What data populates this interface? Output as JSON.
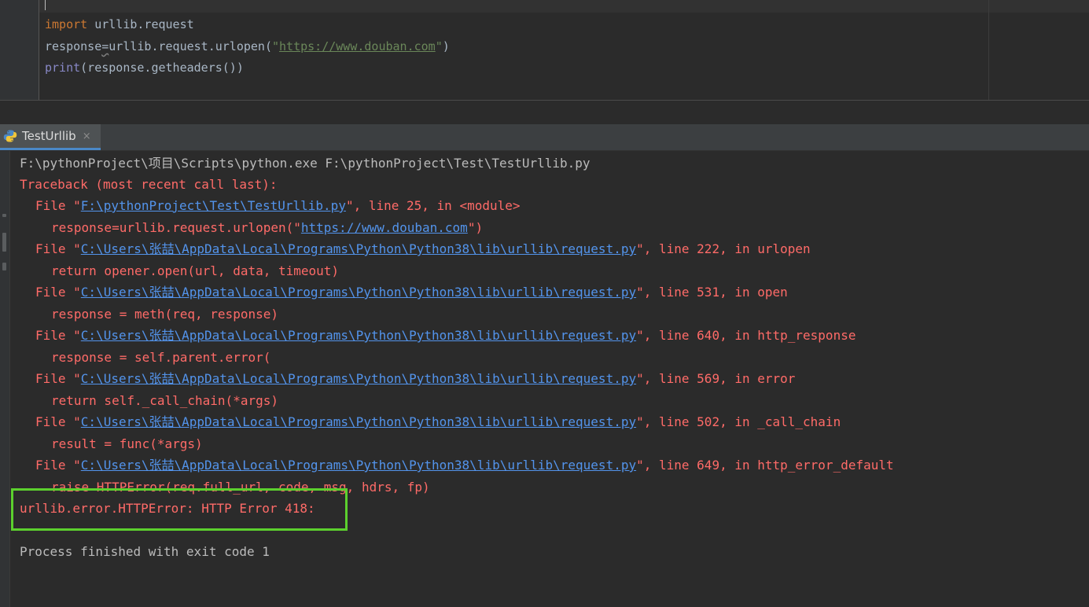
{
  "editor": {
    "lines": [
      {
        "kw": "import",
        "rest": " urllib.request"
      },
      {
        "var": "response",
        "mid": "=urllib.request.urlopen(",
        "q1": "\"",
        "url": "https://www.douban.com",
        "q2": "\"",
        "end": ")"
      },
      {
        "builtin": "print",
        "rest": "(response.getheaders())"
      }
    ]
  },
  "run_panel": {
    "tab_title": "TestUrllib",
    "tab_close": "×",
    "icon": "python-icon"
  },
  "console": {
    "command": "F:\\pythonProject\\项目\\Scripts\\python.exe F:\\pythonProject\\Test\\TestUrllib.py",
    "traceback_header": "Traceback (most recent call last):",
    "frames": [
      {
        "prefix": "File \"",
        "path": "F:\\pythonProject\\Test\\TestUrllib.py",
        "suffix": "\", line 25, in <module>",
        "code_pre": "response=urllib.request.urlopen(\"",
        "code_link": "https://www.douban.com",
        "code_post": "\")"
      },
      {
        "prefix": "File \"",
        "path": "C:\\Users\\张喆\\AppData\\Local\\Programs\\Python\\Python38\\lib\\urllib\\request.py",
        "suffix": "\", line 222, in urlopen",
        "code": "return opener.open(url, data, timeout)"
      },
      {
        "prefix": "File \"",
        "path": "C:\\Users\\张喆\\AppData\\Local\\Programs\\Python\\Python38\\lib\\urllib\\request.py",
        "suffix": "\", line 531, in open",
        "code": "response = meth(req, response)"
      },
      {
        "prefix": "File \"",
        "path": "C:\\Users\\张喆\\AppData\\Local\\Programs\\Python\\Python38\\lib\\urllib\\request.py",
        "suffix": "\", line 640, in http_response",
        "code": "response = self.parent.error("
      },
      {
        "prefix": "File \"",
        "path": "C:\\Users\\张喆\\AppData\\Local\\Programs\\Python\\Python38\\lib\\urllib\\request.py",
        "suffix": "\", line 569, in error",
        "code": "return self._call_chain(*args)"
      },
      {
        "prefix": "File \"",
        "path": "C:\\Users\\张喆\\AppData\\Local\\Programs\\Python\\Python38\\lib\\urllib\\request.py",
        "suffix": "\", line 502, in _call_chain",
        "code": "result = func(*args)"
      },
      {
        "prefix": "File \"",
        "path": "C:\\Users\\张喆\\AppData\\Local\\Programs\\Python\\Python38\\lib\\urllib\\request.py",
        "suffix": "\", line 649, in http_error_default",
        "code": "raise HTTPError(req.full_url, code, msg, hdrs, fp)"
      }
    ],
    "error_line": "urllib.error.HTTPError: HTTP Error 418:",
    "exit_line": "Process finished with exit code 1"
  },
  "colors": {
    "highlight_box": "#5cd02e",
    "error_text": "#ff6b68",
    "link_text": "#5394ec"
  }
}
